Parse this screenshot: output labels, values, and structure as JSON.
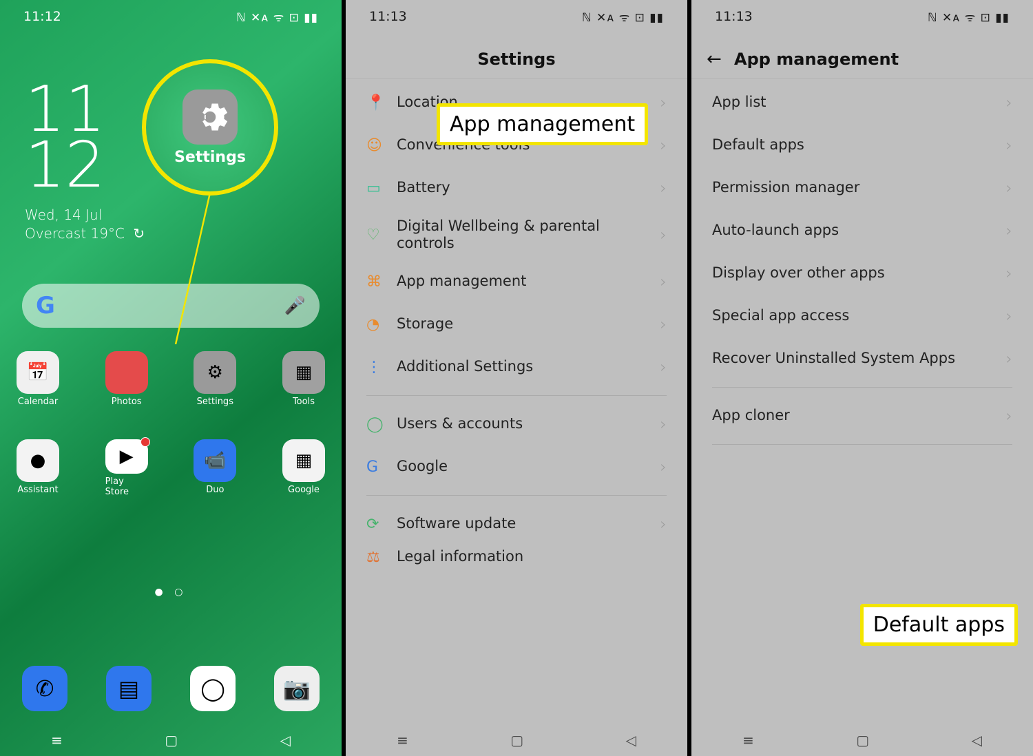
{
  "status": {
    "time1": "11:12",
    "time23": "11:13",
    "right_icons": "ℕ ✕ᴀ ᯤ ⊡ ▮▮"
  },
  "home": {
    "big_hour": "11",
    "big_min": "12",
    "date": "Wed, 14 Jul",
    "weather": "Overcast 19°C",
    "circle_label": "Settings",
    "apps": [
      {
        "label": "Calendar",
        "glyph": "📅",
        "cls": "c-cal"
      },
      {
        "label": "Photos",
        "glyph": "",
        "cls": "c-photos"
      },
      {
        "label": "Settings",
        "glyph": "⚙",
        "cls": "c-sett"
      },
      {
        "label": "Tools",
        "glyph": "▦",
        "cls": "c-tools"
      },
      {
        "label": "Assistant",
        "glyph": "●",
        "cls": "c-asst"
      },
      {
        "label": "Play Store",
        "glyph": "▶",
        "cls": "c-play",
        "dot": true
      },
      {
        "label": "Duo",
        "glyph": "📹",
        "cls": "c-duo"
      },
      {
        "label": "Google",
        "glyph": "▦",
        "cls": "c-google"
      }
    ],
    "dock": [
      {
        "name": "phone",
        "glyph": "✆",
        "cls": "c-phone"
      },
      {
        "name": "messages",
        "glyph": "▤",
        "cls": "c-msg"
      },
      {
        "name": "chrome",
        "glyph": "◯",
        "cls": "c-chrome"
      },
      {
        "name": "camera",
        "glyph": "📷",
        "cls": "c-cam"
      }
    ]
  },
  "settings": {
    "title": "Settings",
    "items": [
      {
        "icon": "📍",
        "label": "Location",
        "color": "#e88b2e"
      },
      {
        "icon": "☺",
        "label": "Convenience tools",
        "color": "#e88b2e"
      },
      {
        "icon": "▭",
        "label": "Battery",
        "color": "#2bbf8f"
      },
      {
        "icon": "♡",
        "label": "Digital Wellbeing & parental controls",
        "color": "#5cb66b",
        "tall": true
      },
      {
        "icon": "⌘",
        "label": "App management",
        "color": "#e88b2e"
      },
      {
        "icon": "◔",
        "label": "Storage",
        "color": "#e88b2e"
      },
      {
        "icon": "⋮",
        "label": "Additional Settings",
        "color": "#3c7de0"
      },
      {
        "hr": true
      },
      {
        "icon": "◯",
        "label": "Users & accounts",
        "color": "#47b36d"
      },
      {
        "icon": "G",
        "label": "Google",
        "color": "#3c7de0"
      },
      {
        "hr": true
      },
      {
        "icon": "⟳",
        "label": "Software update",
        "color": "#47b36d"
      },
      {
        "icon": "⚖",
        "label": "Legal information",
        "color": "#e07434",
        "cut": true
      }
    ]
  },
  "appmgmt": {
    "title": "App management",
    "items": [
      "App list",
      "Default apps",
      "Permission manager",
      "Auto-launch apps",
      "Display over other apps",
      "Special app access",
      "Recover Uninstalled System Apps"
    ],
    "items2": [
      "App cloner"
    ]
  },
  "callouts": {
    "c1": "App management",
    "c2": "Default apps"
  }
}
